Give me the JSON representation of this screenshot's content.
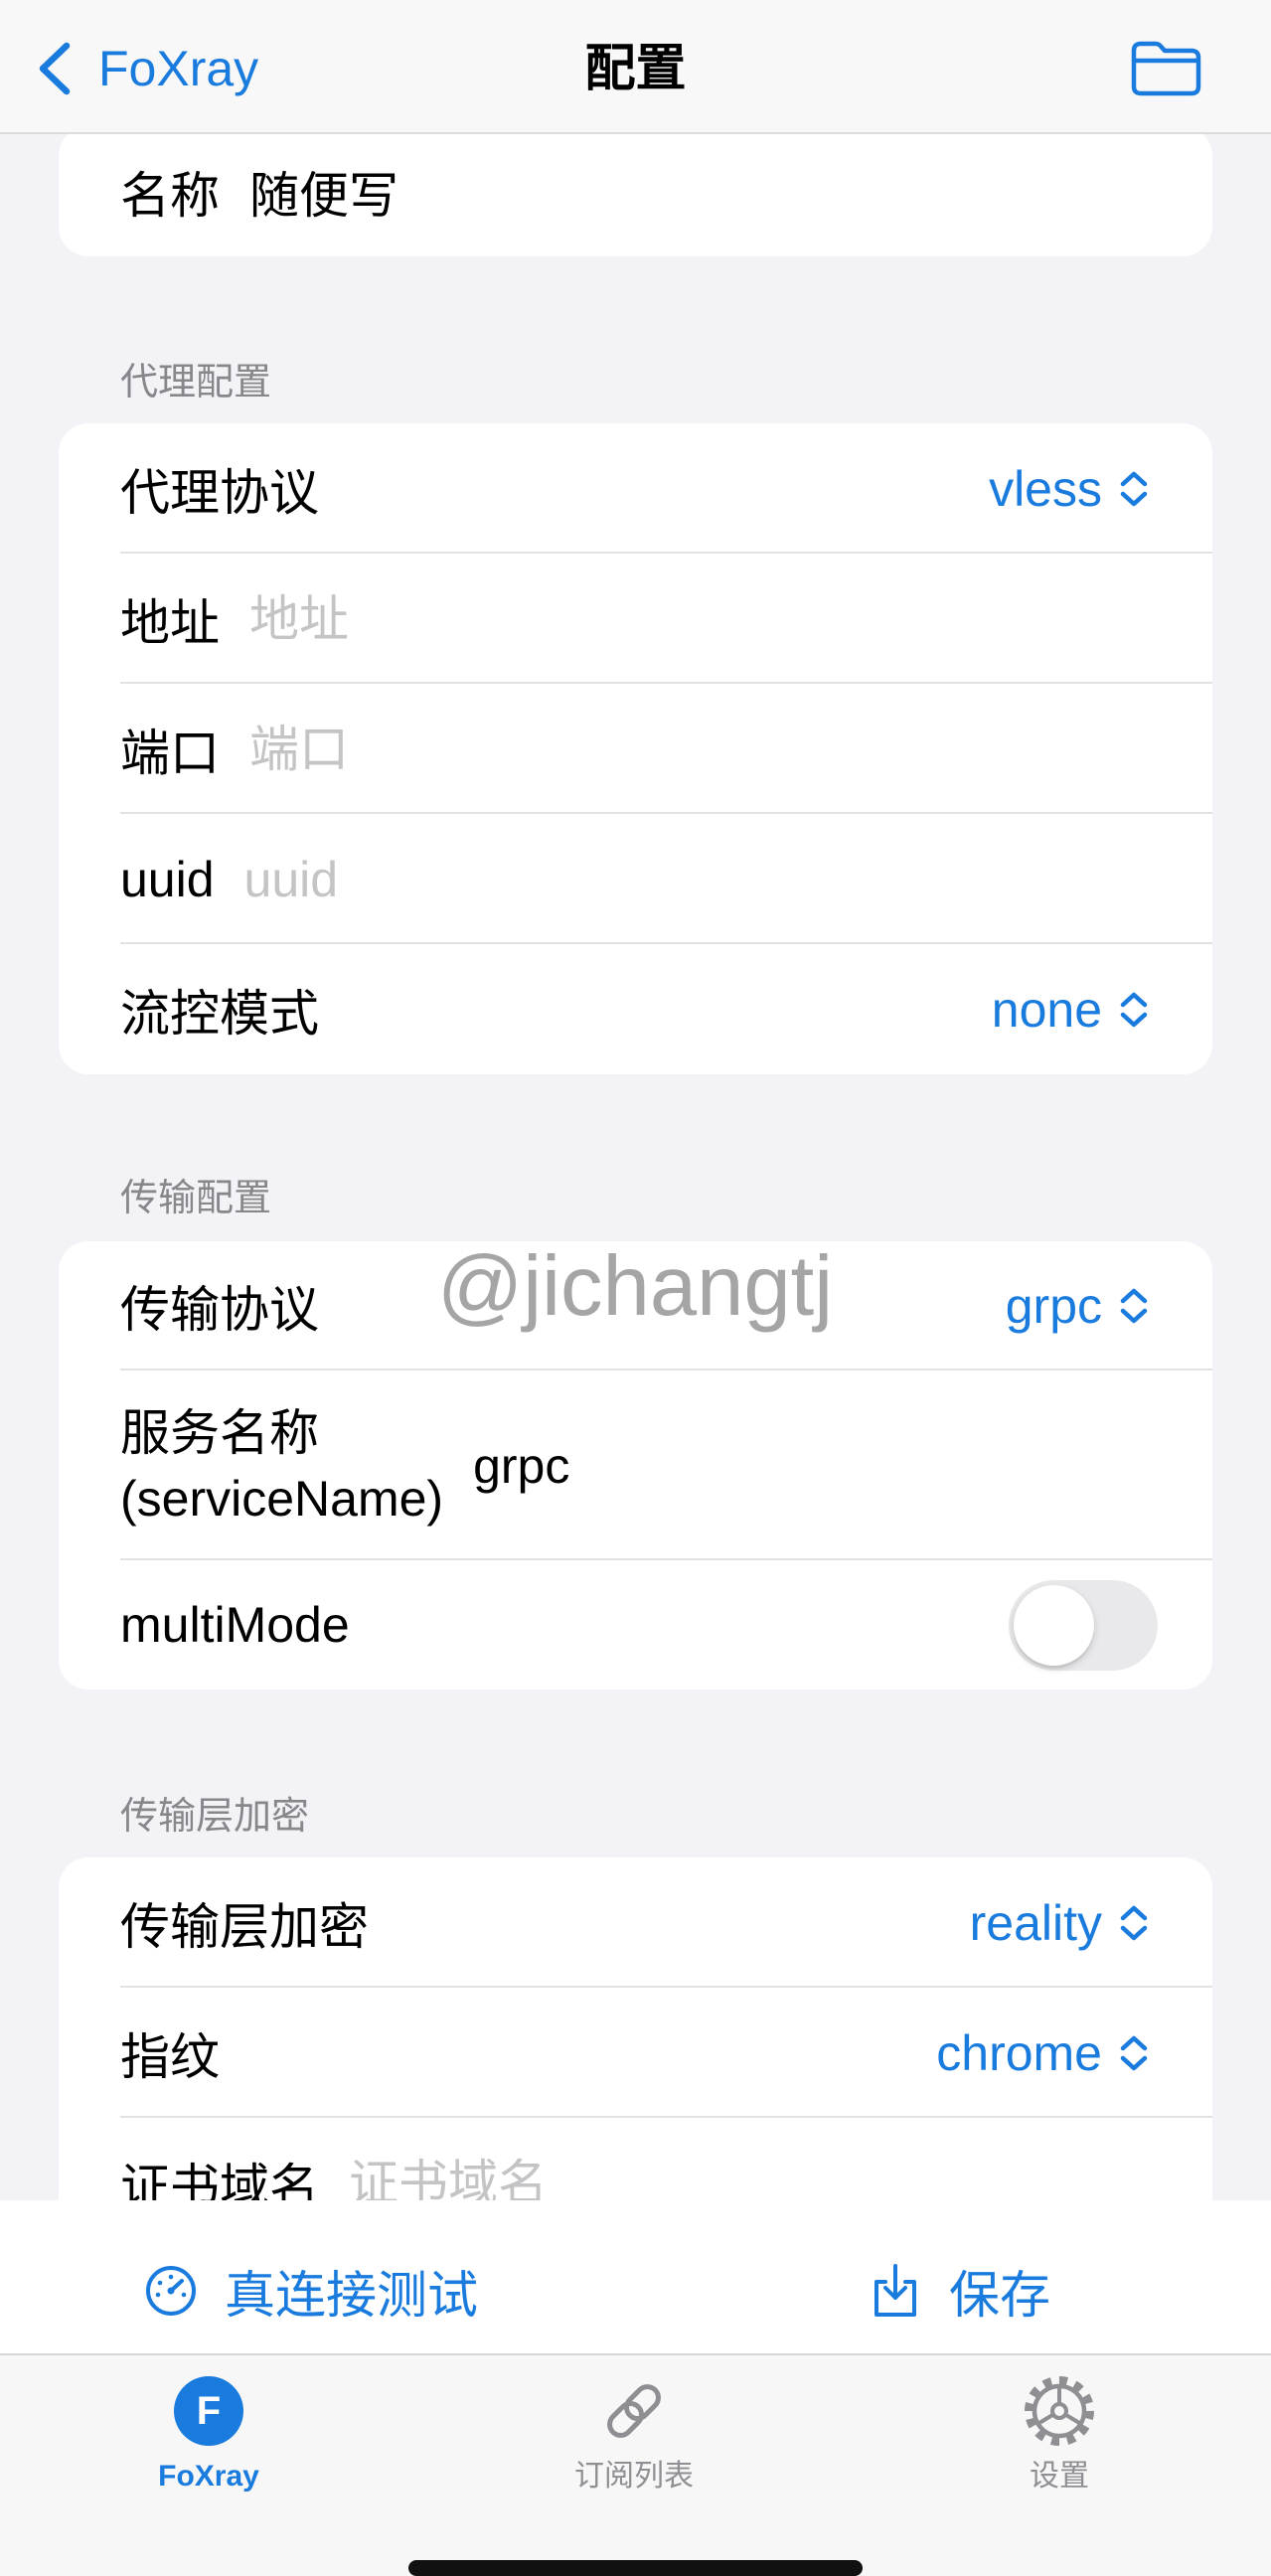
{
  "nav": {
    "back_label": "FoXray",
    "back_icon": "chevron-left-icon",
    "title": "配置",
    "folder_icon": "folder-icon"
  },
  "name_section": {
    "label": "名称",
    "value": "随便写"
  },
  "proxy_section": {
    "header": "代理配置",
    "protocol": {
      "label": "代理协议",
      "value": "vless",
      "icon": "chevron-up-down-icon"
    },
    "address": {
      "label": "地址",
      "placeholder": "地址"
    },
    "port": {
      "label": "端口",
      "placeholder": "端口"
    },
    "uuid": {
      "label": "uuid",
      "placeholder": "uuid"
    },
    "flow": {
      "label": "流控模式",
      "value": "none",
      "icon": "chevron-up-down-icon"
    }
  },
  "transport_section": {
    "header": "传输配置",
    "protocol": {
      "label": "传输协议",
      "value": "grpc",
      "icon": "chevron-up-down-icon"
    },
    "service_name": {
      "label_line1": "服务名称",
      "label_line2": "(serviceName)",
      "value": "grpc"
    },
    "multi_mode": {
      "label": "multiMode",
      "enabled": false
    }
  },
  "tls_section": {
    "header": "传输层加密",
    "security": {
      "label": "传输层加密",
      "value": "reality",
      "icon": "chevron-up-down-icon"
    },
    "fingerprint": {
      "label": "指纹",
      "value": "chrome",
      "icon": "chevron-up-down-icon"
    },
    "server_name": {
      "label": "证书域名",
      "placeholder": "证书域名"
    }
  },
  "watermark": "@jichangtj",
  "actions": {
    "test_label": "真连接测试",
    "test_icon": "speedometer-icon",
    "save_label": "保存",
    "save_icon": "download-tray-icon"
  },
  "tabbar": {
    "items": [
      {
        "label": "FoXray",
        "icon": "foxray-app-icon",
        "glyph": "F",
        "active": true
      },
      {
        "label": "订阅列表",
        "icon": "link-icon",
        "active": false
      },
      {
        "label": "设置",
        "icon": "gear-icon",
        "active": false
      }
    ]
  },
  "colors": {
    "accent": "#1a7bde",
    "background": "#f2f2f7",
    "placeholder": "#c4c4c6",
    "section_header": "#86868b",
    "inactive": "#8e8e93"
  }
}
